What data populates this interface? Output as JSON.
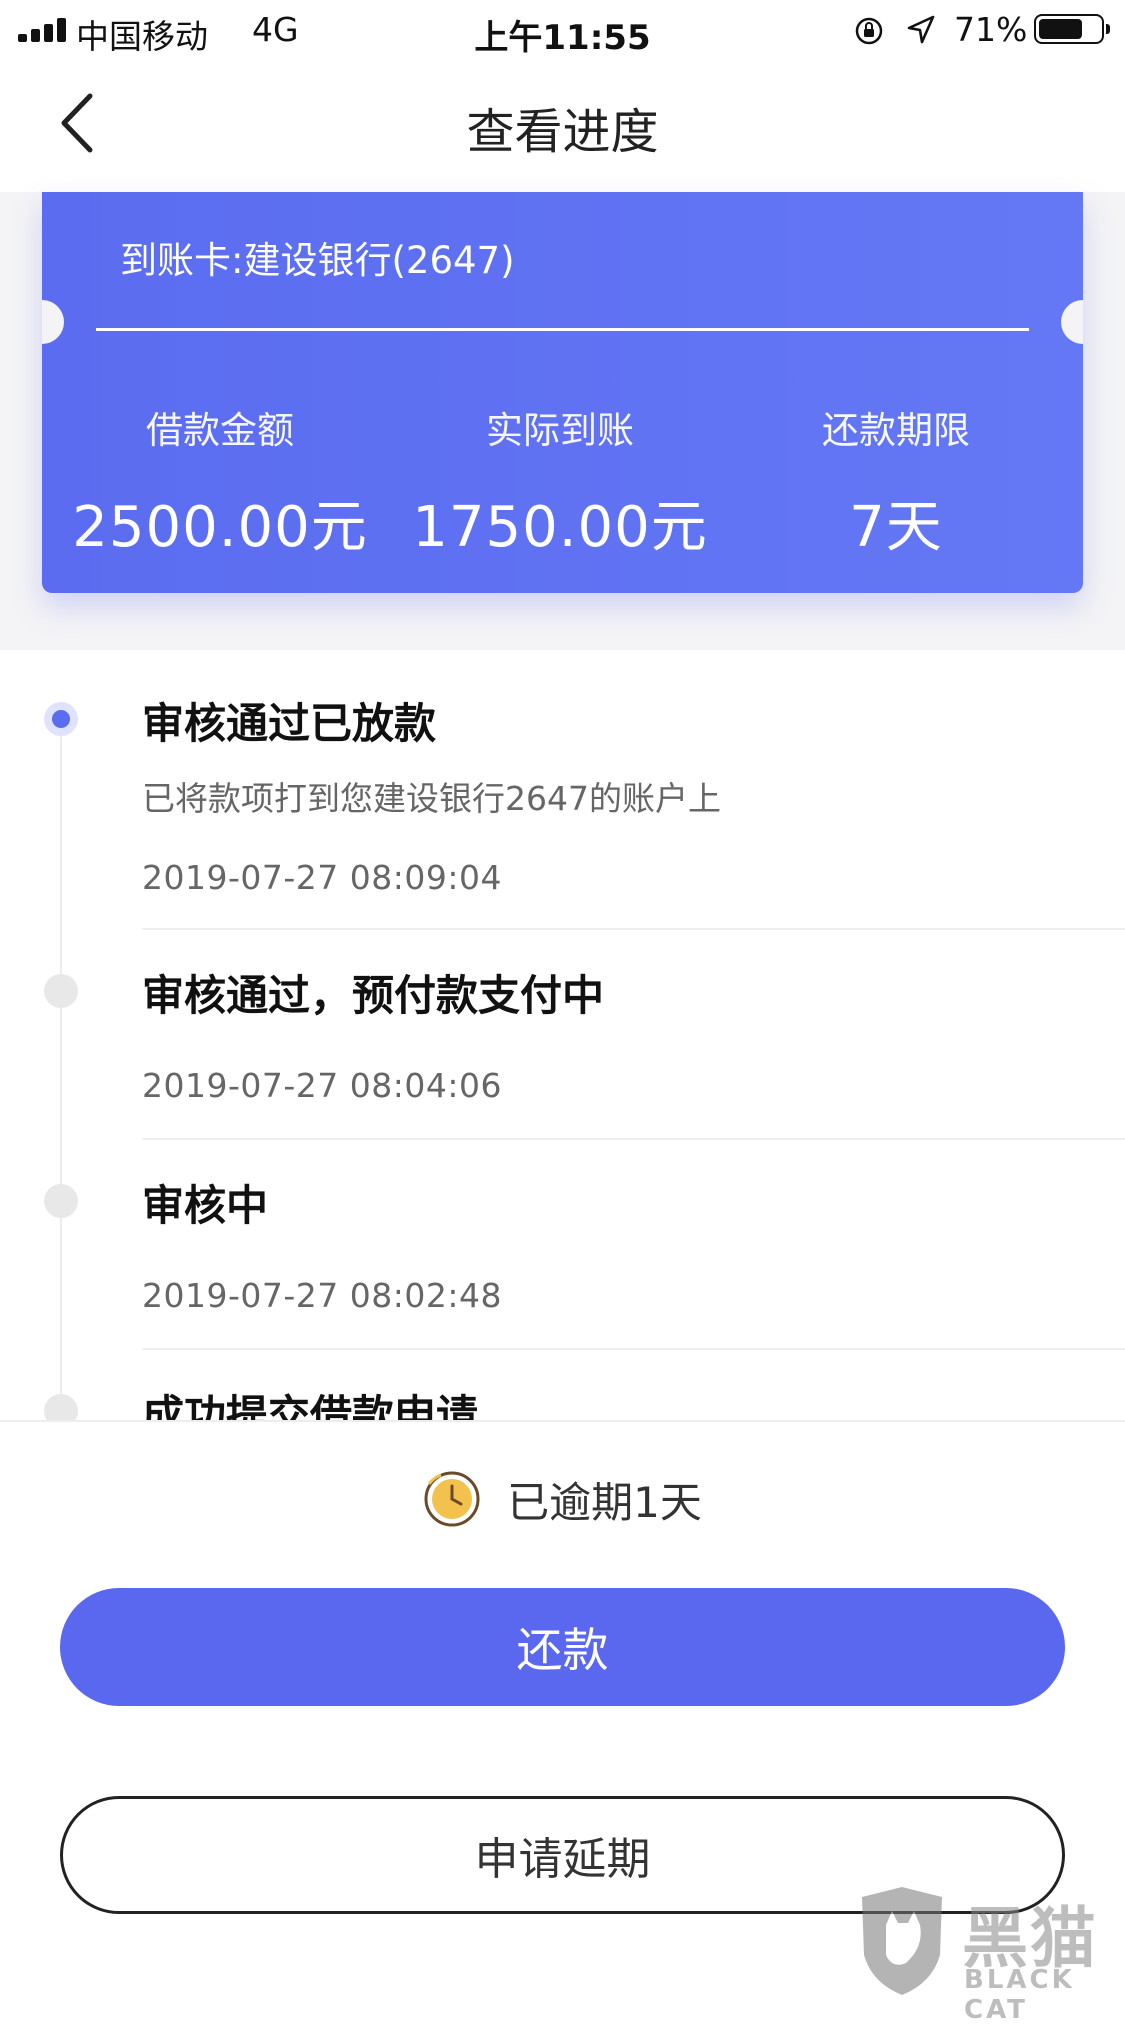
{
  "status_bar": {
    "carrier": "中国移动",
    "network": "4G",
    "time": "上午11:55",
    "battery_percent": "71%",
    "battery_level": 0.71,
    "icons": [
      "signal-bars-icon",
      "orientation-lock-icon",
      "location-arrow-icon",
      "battery-icon"
    ]
  },
  "nav": {
    "title": "查看进度",
    "back_icon": "chevron-left-icon"
  },
  "card": {
    "account": "到账卡:建设银行(2647)",
    "stats": [
      {
        "label": "借款金额",
        "value": "2500.00元"
      },
      {
        "label": "实际到账",
        "value": "1750.00元"
      },
      {
        "label": "还款期限",
        "value": "7天"
      }
    ],
    "colors": {
      "card": "#5b6cf0"
    }
  },
  "timeline": {
    "items": [
      {
        "title": "审核通过已放款",
        "desc": "已将款项打到您建设银行2647的账户上",
        "time": "2019-07-27 08:09:04",
        "active": true
      },
      {
        "title": "审核通过，预付款支付中",
        "time": "2019-07-27 08:04:06",
        "active": false
      },
      {
        "title": "审核中",
        "time": "2019-07-27 08:02:48",
        "active": false
      },
      {
        "title": "成功提交借款申请",
        "active": false
      }
    ]
  },
  "footer": {
    "overdue_icon": "clock-icon",
    "overdue_text": "已逾期1天",
    "repay_label": "还款",
    "extend_label": "申请延期",
    "colors": {
      "primary": "#5a68ef"
    }
  },
  "watermark": {
    "name": "黑猫",
    "en": "BLACK CAT"
  }
}
